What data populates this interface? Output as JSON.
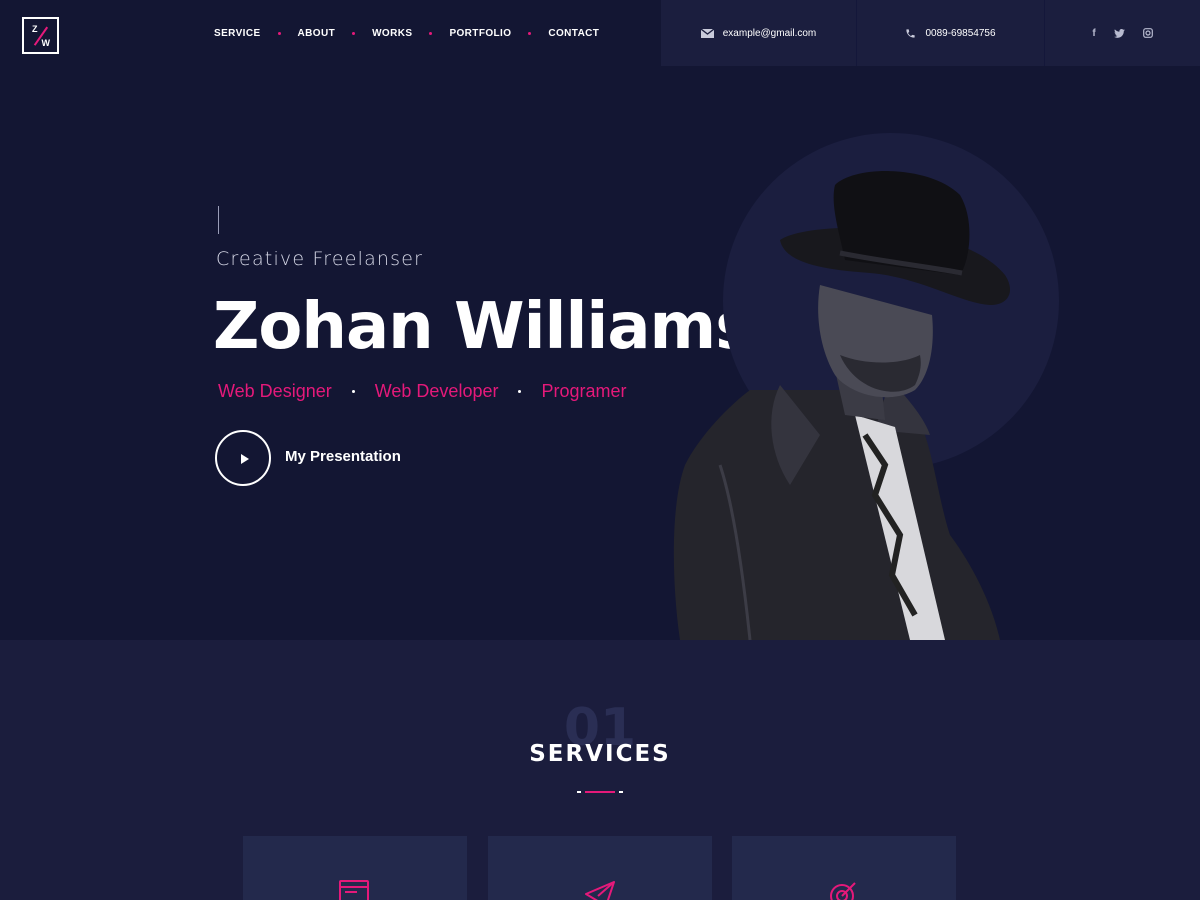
{
  "brand": {
    "logo_top": "Z",
    "logo_bottom": "W",
    "accent_color": "#e5197a"
  },
  "nav": {
    "items": [
      {
        "label": "SERVICE"
      },
      {
        "label": "ABOUT"
      },
      {
        "label": "WORKS"
      },
      {
        "label": "PORTFOLIO"
      },
      {
        "label": "CONTACT"
      }
    ]
  },
  "contact": {
    "email": "example@gmail.com",
    "email_icon": "envelope-icon",
    "phone": "0089-69854756",
    "phone_icon": "phone-icon"
  },
  "social": {
    "facebook": "f",
    "twitter": "t",
    "instagram": "◘"
  },
  "hero": {
    "subtitle": "Creative Freelanser",
    "name": "Zohan Williams",
    "roles": [
      "Web Designer",
      "Web Developer",
      "Programer"
    ],
    "cta_label": "My Presentation"
  },
  "services": {
    "number": "01",
    "title": "SERVICES",
    "cards": [
      {
        "icon": "browser-edit-icon"
      },
      {
        "icon": "paper-plane-icon"
      },
      {
        "icon": "target-icon"
      }
    ]
  }
}
